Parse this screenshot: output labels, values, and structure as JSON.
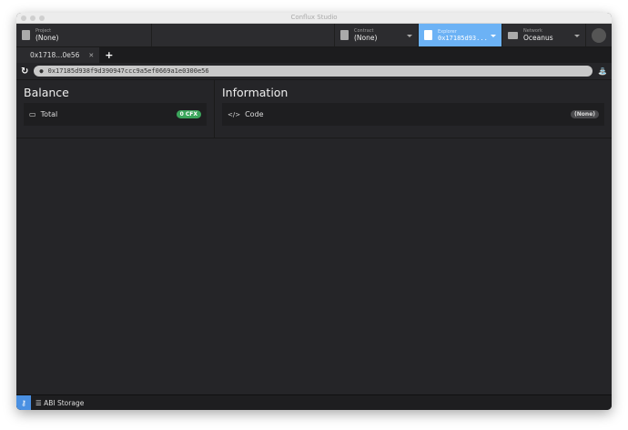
{
  "window": {
    "title": "Conflux Studio"
  },
  "header": {
    "project": {
      "label": "Project",
      "value": "(None)"
    },
    "contract": {
      "label": "Contract",
      "value": "(None)"
    },
    "explorer": {
      "label": "Explorer",
      "value": "0x17185d93..."
    },
    "network": {
      "label": "Network",
      "value": "Oceanus"
    }
  },
  "tabs": [
    {
      "label": "0x1718...0e56",
      "close": "✕"
    }
  ],
  "new_tab": "+",
  "address": "0x17185d938f9d390947ccc9a5ef0669a1e0300e56",
  "balance": {
    "title": "Balance",
    "total_label": "Total",
    "total_value": "0 CFX"
  },
  "information": {
    "title": "Information",
    "code_label": "Code",
    "code_value": "(None)"
  },
  "status": {
    "abi_storage": "ABI Storage"
  },
  "colors": {
    "accent": "#6cb2f5",
    "success": "#3ca55c"
  }
}
